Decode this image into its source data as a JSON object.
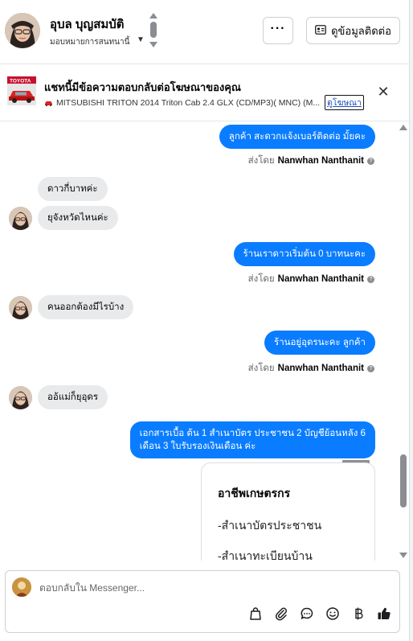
{
  "header": {
    "contact_name": "อุบล บุญสมบัติ",
    "contact_status": "มอบหมายการสนทนานี้",
    "more_label": "···",
    "contact_info_label": "ดูข้อมูลติดต่อ"
  },
  "ad": {
    "title": "แชทนี้มีข้อความตอบกลับต่อโฆษณาของคุณ",
    "subtitle": "MITSUBISHI TRITON 2014 Triton Cab 2.4 GLX (CD/MP3)( MNC) (M...",
    "link_label": "ดูโฆษณา",
    "close_label": "✕",
    "thumb_brand": "TOYOTA"
  },
  "messages": [
    {
      "side": "out",
      "text": "ลูกค้า สะดวกแจ้งเบอร์ติดต่อ มั้ยคะ"
    },
    {
      "side": "meta",
      "prefix": "ส่งโดย",
      "sender": "Nanwhan Nanthanit"
    },
    {
      "side": "in",
      "text": "ดาวกี่บาทค่ะ"
    },
    {
      "side": "in",
      "text": "ยุจังหวัดไหนค่ะ"
    },
    {
      "side": "out",
      "text": "ร้านเราดาวเริ่มต้น  0 บาทนะคะ"
    },
    {
      "side": "meta",
      "prefix": "ส่งโดย",
      "sender": "Nanwhan Nanthanit"
    },
    {
      "side": "in",
      "text": "คนออกต้องมีไรบ้าง"
    },
    {
      "side": "out",
      "text": "ร้านอยู่อุดรนะคะ  ลูกค้า"
    },
    {
      "side": "meta",
      "prefix": "ส่งโดย",
      "sender": "Nanwhan Nanthanit"
    },
    {
      "side": "in",
      "text": "ออ้แม่ก็ยุอุดร"
    },
    {
      "side": "out",
      "line1": "เอกสารเบื้อ ต้น  1 สำเนาบัตร ประชาชน 2 บัญชีย้อนหลัง 6",
      "line2": "เดือน  3 ใบรับรองเงินเดือน ค่ะ"
    }
  ],
  "card": {
    "title": "อาชีพเกษตรกร",
    "lines": [
      "-สำเนาบัตรประชาชน",
      "-สำเนาทะเบียนบ้าน"
    ]
  },
  "composer": {
    "placeholder": "ตอบกลับใน Messenger..."
  },
  "icons": {
    "bag": "bag-icon",
    "attach": "paperclip-icon",
    "saved_reply": "chat-bubble-icon",
    "emoji": "smiley-icon",
    "baht": "baht-icon",
    "like": "thumbs-up-icon"
  },
  "colors": {
    "outgoing_bubble": "#0a7cff",
    "incoming_bubble": "#e9eaeb",
    "link": "#1a4fb8"
  }
}
